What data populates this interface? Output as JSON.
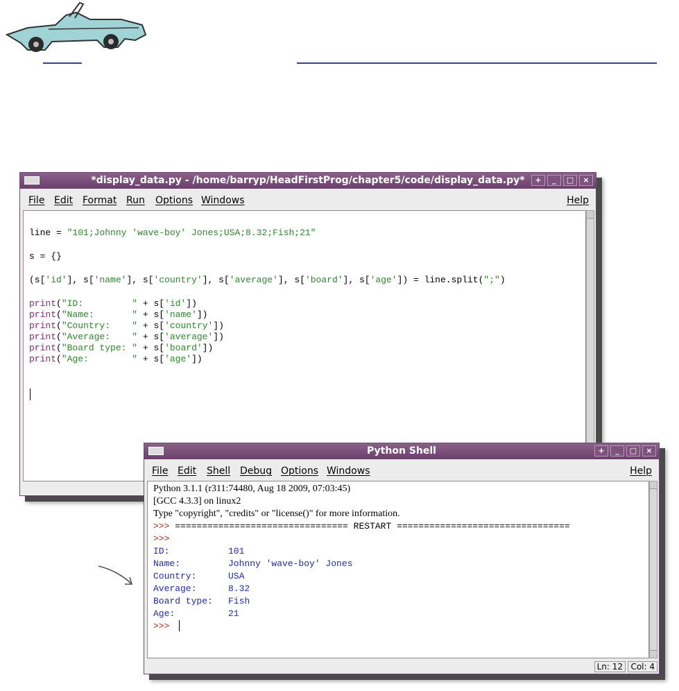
{
  "editor_window": {
    "title": "*display_data.py - /home/barryp/HeadFirstProg/chapter5/code/display_data.py*",
    "menu": [
      "File",
      "Edit",
      "Format",
      "Run",
      "Options",
      "Windows"
    ],
    "help": "Help",
    "code": {
      "line1_a": "line = ",
      "line1_b": "\"101;Johnny 'wave-boy' Jones;USA;8.32;Fish;21\"",
      "line2": "s = {}",
      "line3": [
        {
          "t": "(s[",
          "c": "black"
        },
        {
          "t": "'id'",
          "c": "green"
        },
        {
          "t": "], s[",
          "c": "black"
        },
        {
          "t": "'name'",
          "c": "green"
        },
        {
          "t": "], s[",
          "c": "black"
        },
        {
          "t": "'country'",
          "c": "green"
        },
        {
          "t": "], s[",
          "c": "black"
        },
        {
          "t": "'average'",
          "c": "green"
        },
        {
          "t": "], s[",
          "c": "black"
        },
        {
          "t": "'board'",
          "c": "green"
        },
        {
          "t": "], s[",
          "c": "black"
        },
        {
          "t": "'age'",
          "c": "green"
        },
        {
          "t": "]) = line.split(",
          "c": "black"
        },
        {
          "t": "\";\"",
          "c": "green"
        },
        {
          "t": ")",
          "c": "black"
        }
      ],
      "prints": [
        {
          "kw": "print",
          "open": "(",
          "str": "\"ID:         \"",
          "mid": " + s[",
          "key": "'id'",
          "close": "])"
        },
        {
          "kw": "print",
          "open": "(",
          "str": "\"Name:       \"",
          "mid": " + s[",
          "key": "'name'",
          "close": "])"
        },
        {
          "kw": "print",
          "open": "(",
          "str": "\"Country:    \"",
          "mid": " + s[",
          "key": "'country'",
          "close": "])"
        },
        {
          "kw": "print",
          "open": "(",
          "str": "\"Average:    \"",
          "mid": " + s[",
          "key": "'average'",
          "close": "])"
        },
        {
          "kw": "print",
          "open": "(",
          "str": "\"Board type: \"",
          "mid": " + s[",
          "key": "'board'",
          "close": "])"
        },
        {
          "kw": "print",
          "open": "(",
          "str": "\"Age:        \"",
          "mid": " + s[",
          "key": "'age'",
          "close": "])"
        }
      ]
    }
  },
  "shell_window": {
    "title": "Python Shell",
    "menu": [
      "File",
      "Edit",
      "Shell",
      "Debug",
      "Options",
      "Windows"
    ],
    "help": "Help",
    "lines": {
      "banner1": "Python 3.1.1 (r311:74480, Aug 18 2009, 07:03:45)",
      "banner2": "[GCC 4.3.3] on linux2",
      "banner3": "Type \"copyright\", \"credits\" or \"license()\" for more information.",
      "restart_prompt": ">>> ",
      "restart_text": "================================ RESTART ================================",
      "prompt2": ">>>",
      "prompt_last": ">>> "
    },
    "output": [
      {
        "label": "ID:",
        "value": "101"
      },
      {
        "label": "Name:",
        "value": "Johnny 'wave-boy' Jones"
      },
      {
        "label": "Country:",
        "value": "USA"
      },
      {
        "label": "Average:",
        "value": "8.32"
      },
      {
        "label": "Board type:",
        "value": "Fish"
      },
      {
        "label": "Age:",
        "value": "21"
      }
    ],
    "status": {
      "ln": "Ln: 12",
      "col": "Col: 4"
    }
  },
  "colors": {
    "title_bar": "#7a4d7a",
    "string_green": "#2a8a2a",
    "keyword_purple": "#8c1f8c",
    "output_blue": "#1f2ab8",
    "prompt_red": "#b22222"
  },
  "icons": [
    "car-illustration",
    "window-icon",
    "maximize-icon",
    "minimize-icon",
    "restore-icon",
    "close-icon",
    "hand-drawn-arrow"
  ]
}
